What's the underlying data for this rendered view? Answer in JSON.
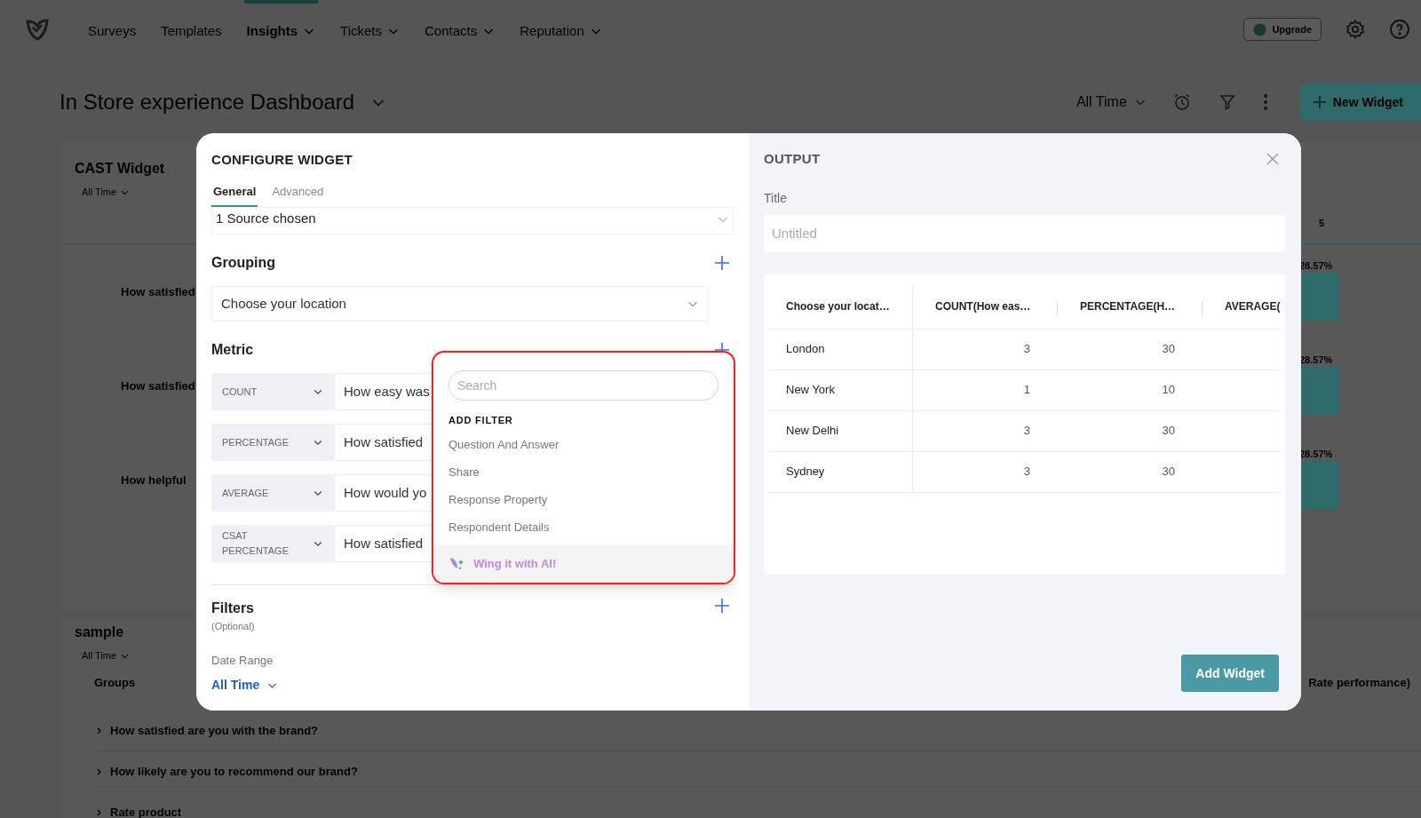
{
  "nav": {
    "items": [
      {
        "label": "Surveys",
        "selected": false,
        "dropdown": false
      },
      {
        "label": "Templates",
        "selected": false,
        "dropdown": false
      },
      {
        "label": "Insights",
        "selected": true,
        "dropdown": true
      },
      {
        "label": "Tickets",
        "selected": false,
        "dropdown": true
      },
      {
        "label": "Contacts",
        "selected": false,
        "dropdown": true
      },
      {
        "label": "Reputation",
        "selected": false,
        "dropdown": true
      }
    ],
    "upgrade": "Upgrade"
  },
  "dashboard": {
    "title": "In Store experience Dashboard",
    "range": "All Time",
    "new_widget": "New Widget"
  },
  "widget_card": {
    "title": "CAST Widget",
    "range": "All Time",
    "tab": "5",
    "rows": [
      {
        "question": "How satisfied",
        "value": "28.57%"
      },
      {
        "question": "How satisfied",
        "value": "28.57%"
      },
      {
        "question": "How helpful",
        "value": "28.57%"
      }
    ]
  },
  "sample_card": {
    "title": "sample",
    "range": "All Time",
    "groups_label": "Groups",
    "column_label": "Rate performance)",
    "groups": [
      "How satisfied are you with the brand?",
      "How likely are you to recommend our brand?",
      "Rate product"
    ]
  },
  "configure": {
    "title": "CONFIGURE WIDGET",
    "tabs": [
      {
        "label": "General",
        "selected": true
      },
      {
        "label": "Advanced",
        "selected": false
      }
    ],
    "source": "1 Source chosen",
    "grouping": {
      "label": "Grouping",
      "value": "Choose your location"
    },
    "metric": {
      "label": "Metric",
      "rows": [
        {
          "aggregate": "COUNT",
          "question": "How easy was"
        },
        {
          "aggregate": "PERCENTAGE",
          "question": "How satisfied"
        },
        {
          "aggregate": "AVERAGE",
          "question": "How would yo"
        },
        {
          "aggregate": "CSAT PERCENTAGE",
          "question": "How satisfied"
        }
      ]
    },
    "filters": {
      "label": "Filters",
      "hint": "(Optional)",
      "date_range_label": "Date Range",
      "date_range": "All Time"
    }
  },
  "filter_menu": {
    "placeholder": "Search",
    "heading": "ADD FILTER",
    "items": [
      "Question And Answer",
      "Share",
      "Response Property",
      "Respondent Details"
    ],
    "ai": "Wing it with AI!"
  },
  "output": {
    "title": "OUTPUT",
    "title_field": {
      "label": "Title",
      "placeholder": "Untitled"
    },
    "table": {
      "columns": [
        "Choose your locat…",
        "COUNT(How eas…",
        "PERCENTAGE(H…",
        "AVERAGE("
      ],
      "rows": [
        [
          "London",
          "3",
          "30"
        ],
        [
          "New York",
          "1",
          "10"
        ],
        [
          "New Delhi",
          "3",
          "30"
        ],
        [
          "Sydney",
          "3",
          "30"
        ]
      ]
    },
    "add_button": "Add Widget"
  }
}
